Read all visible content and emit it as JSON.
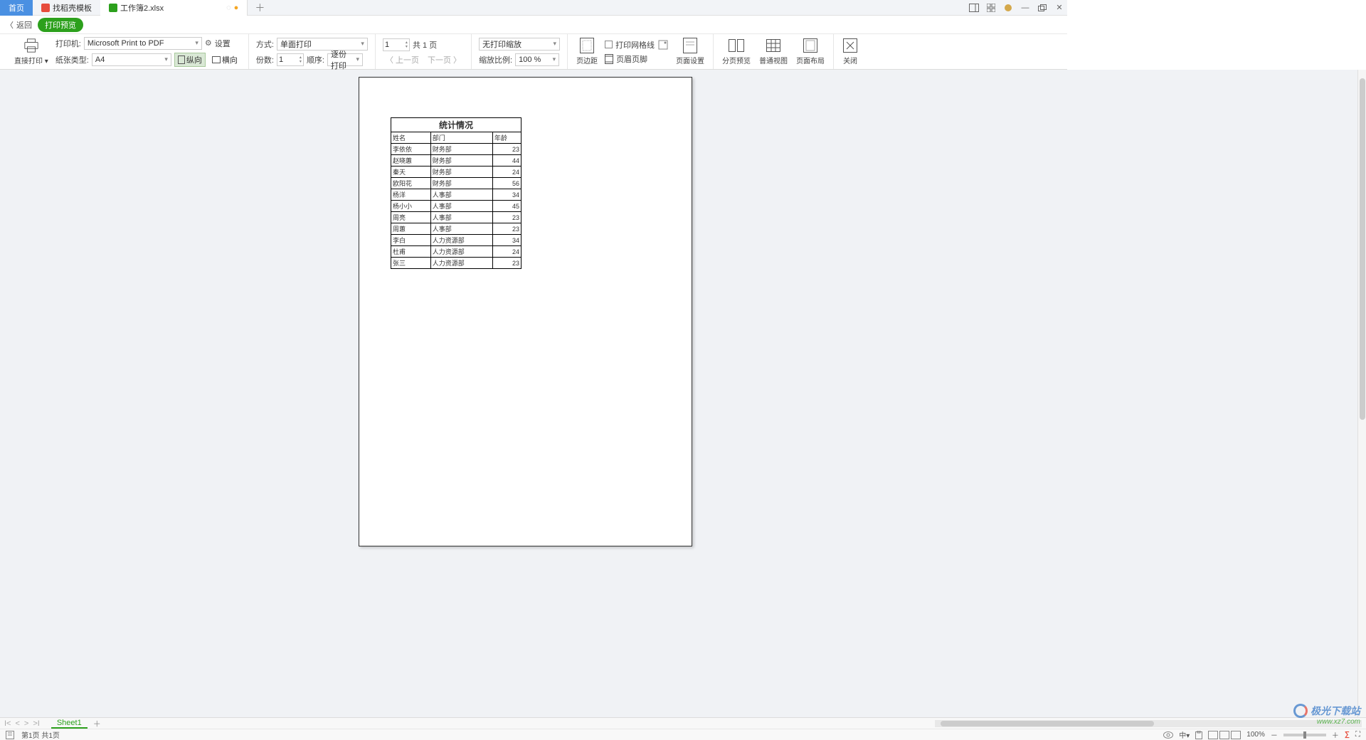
{
  "tabs": {
    "home": "首页",
    "template": "找稻壳模板",
    "file": "工作簿2.xlsx"
  },
  "breadcrumb": {
    "back": "返回",
    "pill": "打印预览"
  },
  "toolbar": {
    "direct_print": "直接打印",
    "printer_label": "打印机:",
    "printer_value": "Microsoft Print to PDF",
    "settings": "设置",
    "paper_type_label": "纸张类型:",
    "paper_type_value": "A4",
    "portrait": "纵向",
    "landscape": "横向",
    "mode_label": "方式:",
    "mode_value": "单面打印",
    "copies_label": "份数:",
    "copies_value": "1",
    "order_label": "顺序:",
    "order_value": "逐份打印",
    "page_current": "1",
    "page_total_prefix": "共",
    "page_total_suffix": "页",
    "page_total": "1",
    "prev_page": "上一页",
    "next_page": "下一页",
    "scaling_value": "无打印缩放",
    "zoom_label": "缩放比例:",
    "zoom_value": "100 %",
    "margins": "页边距",
    "print_gridlines": "打印网格线",
    "header_footer": "页眉页脚",
    "page_setup": "页面设置",
    "page_break_preview": "分页预览",
    "normal_view": "普通视图",
    "page_layout": "页面布局",
    "close": "关闭"
  },
  "chart_data": {
    "type": "table",
    "title": "统计情况",
    "columns": [
      "姓名",
      "部门",
      "年龄"
    ],
    "rows": [
      [
        "李依依",
        "财务部",
        23
      ],
      [
        "赵晓蕙",
        "财务部",
        44
      ],
      [
        "秦天",
        "财务部",
        24
      ],
      [
        "欧阳花",
        "财务部",
        56
      ],
      [
        "杨洋",
        "人事部",
        34
      ],
      [
        "杨小小",
        "人事部",
        45
      ],
      [
        "周亮",
        "人事部",
        23
      ],
      [
        "周蕙",
        "人事部",
        23
      ],
      [
        "李白",
        "人力资源部",
        34
      ],
      [
        "杜甫",
        "人力资源部",
        24
      ],
      [
        "张三",
        "人力资源部",
        23
      ]
    ]
  },
  "sheet": {
    "name": "Sheet1"
  },
  "status": {
    "page_info": "第1页 共1页",
    "lang": "中",
    "zoom": "100%"
  },
  "watermark": {
    "text": "极光下载站",
    "url": "www.xz7.com"
  }
}
